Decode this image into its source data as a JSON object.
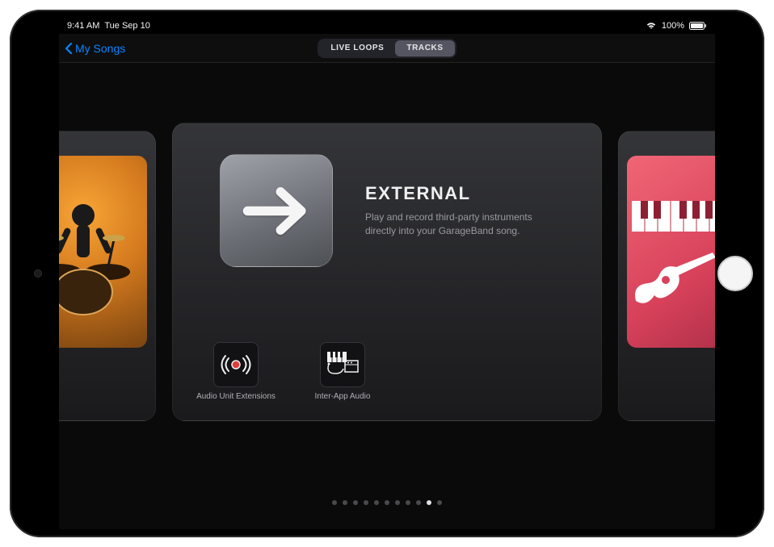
{
  "status_bar": {
    "time": "9:41 AM",
    "date": "Tue Sep 10",
    "battery_text": "100%"
  },
  "nav": {
    "back_label": "My Songs",
    "segments": {
      "live_loops": "LIVE LOOPS",
      "tracks": "TRACKS"
    },
    "selected_segment": "tracks"
  },
  "carousel": {
    "center": {
      "title": "EXTERNAL",
      "description": "Play and record third-party instruments directly into your GarageBand song.",
      "options": {
        "audio_unit": "Audio Unit Extensions",
        "inter_app": "Inter-App Audio"
      }
    }
  },
  "pagination": {
    "total": 11,
    "current_index": 9
  }
}
